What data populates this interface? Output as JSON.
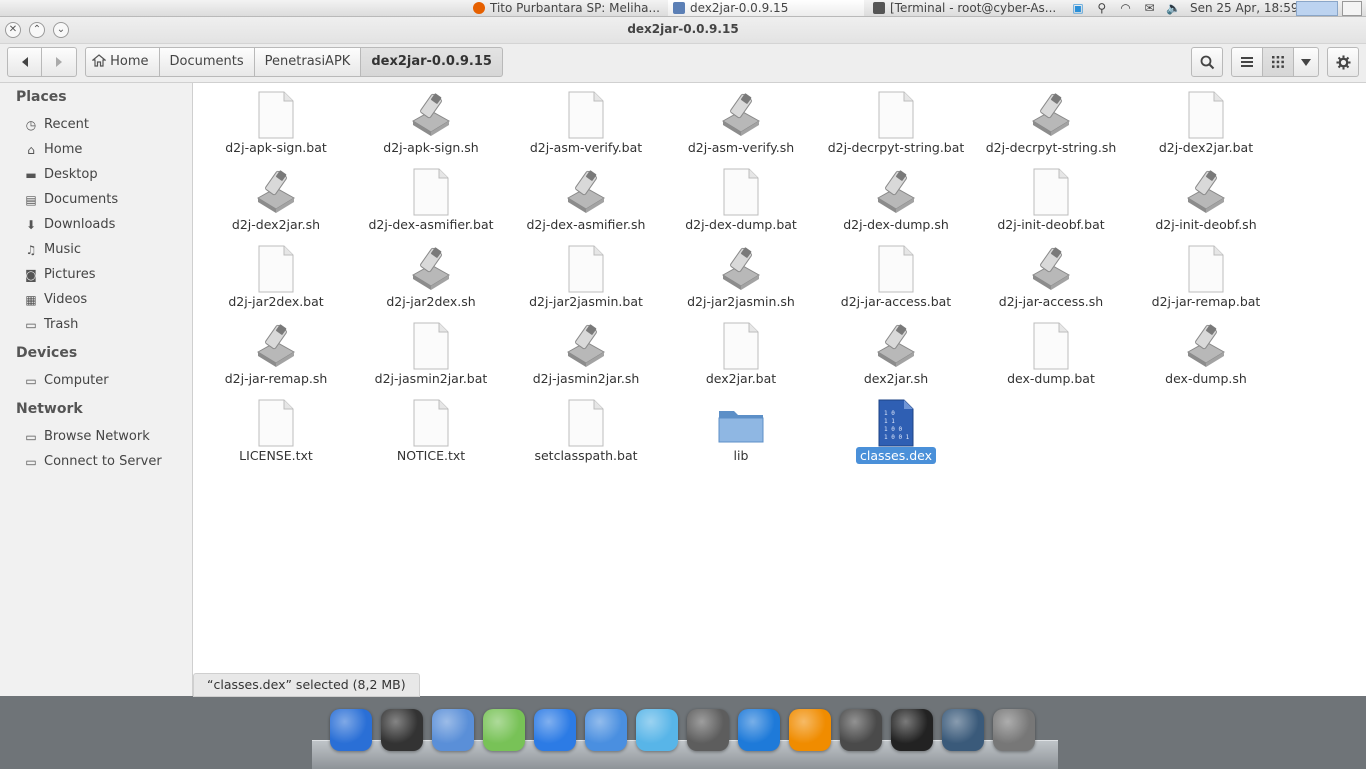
{
  "top_panel": {
    "tasks": [
      {
        "label": "Tito Purbantara SP: Meliha...",
        "icon": "firefox-icon",
        "color": "#e66000"
      },
      {
        "label": "dex2jar-0.0.9.15",
        "icon": "file-manager-icon",
        "color": "#5b7fb5"
      },
      {
        "label": "[Terminal - root@cyber-As...",
        "icon": "terminal-icon",
        "color": "#555555"
      }
    ],
    "clock": "Sen 25 Apr, 18:59"
  },
  "window": {
    "title": "dex2jar-0.0.9.15"
  },
  "breadcrumb": [
    {
      "label": "Home",
      "icon": "home-icon"
    },
    {
      "label": "Documents"
    },
    {
      "label": "PenetrasiAPK"
    },
    {
      "label": "dex2jar-0.0.9.15",
      "current": true
    }
  ],
  "sidebar": {
    "places_heading": "Places",
    "places": [
      {
        "label": "Recent",
        "icon": "clock-icon"
      },
      {
        "label": "Home",
        "icon": "home-icon"
      },
      {
        "label": "Desktop",
        "icon": "desktop-folder-icon"
      },
      {
        "label": "Documents",
        "icon": "documents-icon"
      },
      {
        "label": "Downloads",
        "icon": "download-icon"
      },
      {
        "label": "Music",
        "icon": "music-icon"
      },
      {
        "label": "Pictures",
        "icon": "camera-icon"
      },
      {
        "label": "Videos",
        "icon": "film-icon"
      },
      {
        "label": "Trash",
        "icon": "trash-icon"
      }
    ],
    "devices_heading": "Devices",
    "devices": [
      {
        "label": "Computer",
        "icon": "drive-icon"
      }
    ],
    "network_heading": "Network",
    "network": [
      {
        "label": "Browse Network",
        "icon": "network-icon"
      },
      {
        "label": "Connect to Server",
        "icon": "network-icon"
      }
    ]
  },
  "files": [
    {
      "name": "d2j-apk-sign.bat",
      "type": "doc"
    },
    {
      "name": "d2j-apk-sign.sh",
      "type": "script"
    },
    {
      "name": "d2j-asm-verify.bat",
      "type": "doc"
    },
    {
      "name": "d2j-asm-verify.sh",
      "type": "script"
    },
    {
      "name": "d2j-decrpyt-string.bat",
      "type": "doc"
    },
    {
      "name": "d2j-decrpyt-string.sh",
      "type": "script"
    },
    {
      "name": "d2j-dex2jar.bat",
      "type": "doc"
    },
    {
      "name": "d2j-dex2jar.sh",
      "type": "script"
    },
    {
      "name": "d2j-dex-asmifier.bat",
      "type": "doc"
    },
    {
      "name": "d2j-dex-asmifier.sh",
      "type": "script"
    },
    {
      "name": "d2j-dex-dump.bat",
      "type": "doc"
    },
    {
      "name": "d2j-dex-dump.sh",
      "type": "script"
    },
    {
      "name": "d2j-init-deobf.bat",
      "type": "doc"
    },
    {
      "name": "d2j-init-deobf.sh",
      "type": "script"
    },
    {
      "name": "d2j-jar2dex.bat",
      "type": "doc"
    },
    {
      "name": "d2j-jar2dex.sh",
      "type": "script"
    },
    {
      "name": "d2j-jar2jasmin.bat",
      "type": "doc"
    },
    {
      "name": "d2j-jar2jasmin.sh",
      "type": "script"
    },
    {
      "name": "d2j-jar-access.bat",
      "type": "doc"
    },
    {
      "name": "d2j-jar-access.sh",
      "type": "script"
    },
    {
      "name": "d2j-jar-remap.bat",
      "type": "doc"
    },
    {
      "name": "d2j-jar-remap.sh",
      "type": "script"
    },
    {
      "name": "d2j-jasmin2jar.bat",
      "type": "doc"
    },
    {
      "name": "d2j-jasmin2jar.sh",
      "type": "script"
    },
    {
      "name": "dex2jar.bat",
      "type": "doc"
    },
    {
      "name": "dex2jar.sh",
      "type": "script"
    },
    {
      "name": "dex-dump.bat",
      "type": "doc"
    },
    {
      "name": "dex-dump.sh",
      "type": "script"
    },
    {
      "name": "LICENSE.txt",
      "type": "doc"
    },
    {
      "name": "NOTICE.txt",
      "type": "doc"
    },
    {
      "name": "setclasspath.bat",
      "type": "doc"
    },
    {
      "name": "lib",
      "type": "folder"
    },
    {
      "name": "classes.dex",
      "type": "binary",
      "selected": true
    }
  ],
  "statusbar": {
    "text": "“classes.dex” selected  (8,2 MB)"
  },
  "dock": [
    {
      "icon": "network-globe-icon",
      "color": "#2a6fd6"
    },
    {
      "icon": "unity-icon",
      "color": "#333333"
    },
    {
      "icon": "browser-icon",
      "color": "#5a8fd8"
    },
    {
      "icon": "android-studio-icon",
      "color": "#78c257"
    },
    {
      "icon": "download-manager-icon",
      "color": "#2c7be5"
    },
    {
      "icon": "finder-icon",
      "color": "#4a8fe0"
    },
    {
      "icon": "ppsspp-icon",
      "color": "#58b5e8"
    },
    {
      "icon": "steam-icon",
      "color": "#5d5d5d"
    },
    {
      "icon": "app-store-icon",
      "color": "#1e7ad9"
    },
    {
      "icon": "vlc-icon",
      "color": "#f08c00"
    },
    {
      "icon": "sublime-text-icon",
      "color": "#4a4a4a"
    },
    {
      "icon": "terminal-icon",
      "color": "#222222"
    },
    {
      "icon": "screenshot-icon",
      "color": "#3a5a7a"
    },
    {
      "icon": "launchpad-icon",
      "color": "#777777"
    }
  ]
}
